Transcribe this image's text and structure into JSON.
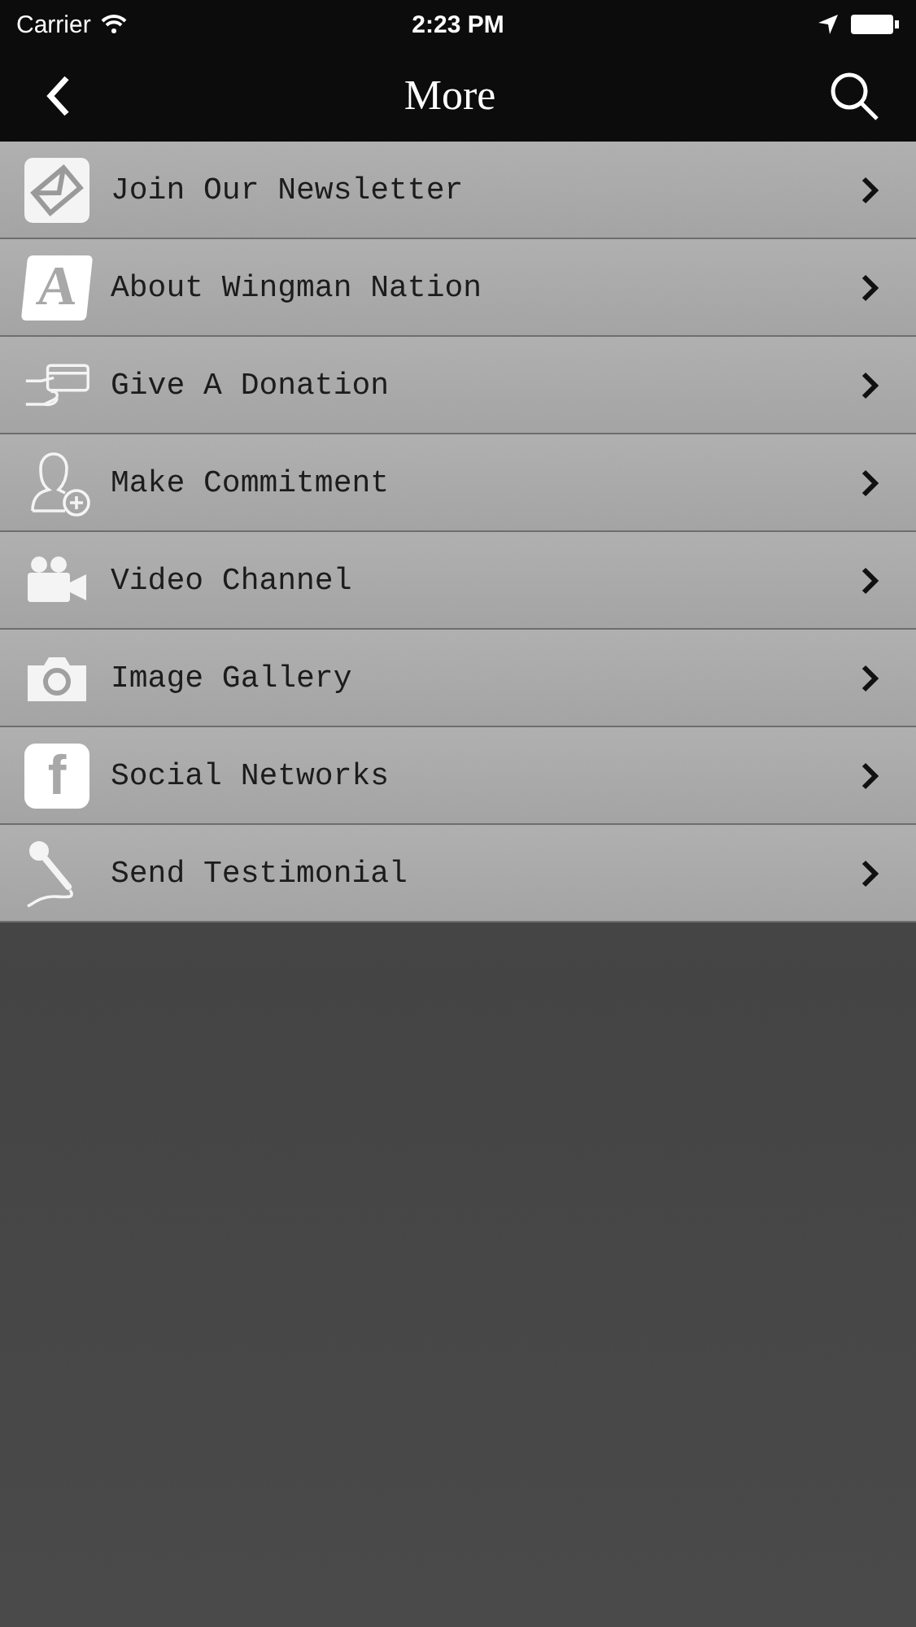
{
  "status_bar": {
    "carrier": "Carrier",
    "time": "2:23 PM"
  },
  "nav": {
    "title": "More"
  },
  "items": [
    {
      "kind": "newsletter",
      "label": "Join Our Newsletter"
    },
    {
      "kind": "about",
      "label": "About Wingman Nation",
      "glyph": "A"
    },
    {
      "kind": "donation",
      "label": "Give A Donation"
    },
    {
      "kind": "commitment",
      "label": "Make Commitment"
    },
    {
      "kind": "video",
      "label": "Video Channel"
    },
    {
      "kind": "gallery",
      "label": "Image Gallery"
    },
    {
      "kind": "social",
      "label": "Social Networks",
      "glyph": "f"
    },
    {
      "kind": "testimonial",
      "label": "Send Testimonial"
    }
  ]
}
